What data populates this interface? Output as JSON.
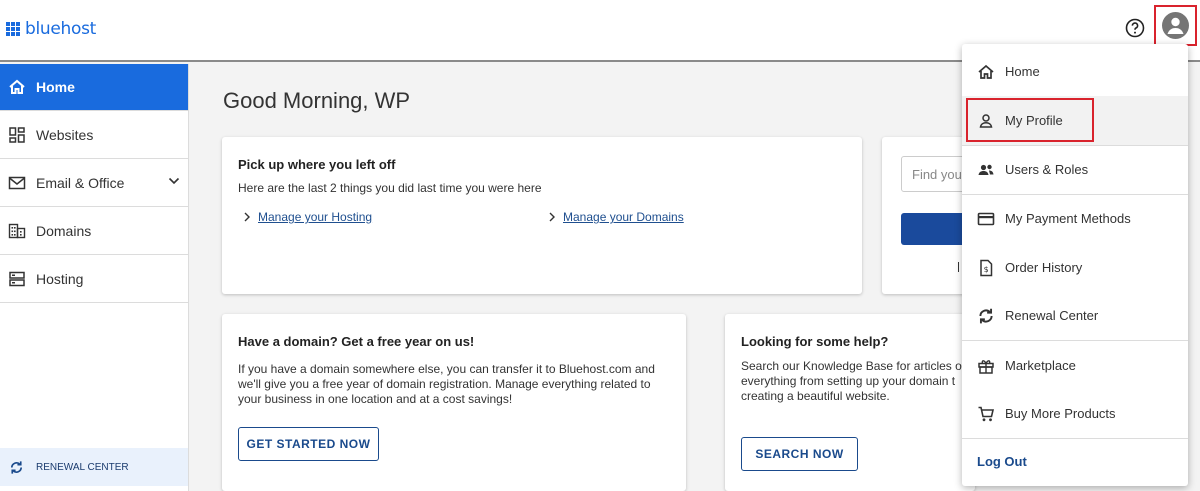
{
  "brand": {
    "name": "bluehost",
    "color": "#196bde"
  },
  "header": {
    "help_icon": "help-circle-icon",
    "avatar_icon": "account-circle-icon"
  },
  "sidebar": {
    "items": [
      {
        "label": "Home",
        "icon": "home-icon",
        "active": true
      },
      {
        "label": "Websites",
        "icon": "dashboard-icon"
      },
      {
        "label": "Email & Office",
        "icon": "mail-icon",
        "expandable": true
      },
      {
        "label": "Domains",
        "icon": "building-icon"
      },
      {
        "label": "Hosting",
        "icon": "server-icon"
      }
    ],
    "renewal_label": "RENEWAL CENTER"
  },
  "main": {
    "greeting": "Good Morning, WP",
    "pickup_card": {
      "title": "Pick up where you left off",
      "subtitle": "Here are the last 2 things you did last time you were here",
      "links": [
        "Manage your Hosting",
        "Manage your Domains"
      ]
    },
    "search_card": {
      "placeholder": "Find you"
    },
    "domain_card": {
      "title": "Have a domain? Get a free year on us!",
      "body": "If you have a domain somewhere else, you can transfer it to Bluehost.com and we'll give you a free year of domain registration. Manage everything related to your business in one location and at a cost savings!",
      "button": "GET STARTED NOW"
    },
    "help_card": {
      "title": "Looking for some help?",
      "body_lines": [
        "Search our Knowledge Base for articles o",
        "everything from setting up your domain t",
        "creating a beautiful website."
      ],
      "button": "SEARCH NOW"
    }
  },
  "menu": {
    "items": [
      {
        "label": "Home",
        "icon": "home-icon"
      },
      {
        "label": "My Profile",
        "icon": "person-icon"
      },
      {
        "label": "Users & Roles",
        "icon": "people-icon"
      },
      {
        "label": "My Payment Methods",
        "icon": "credit-card-icon"
      },
      {
        "label": "Order History",
        "icon": "receipt-icon"
      },
      {
        "label": "Renewal Center",
        "icon": "refresh-icon"
      },
      {
        "label": "Marketplace",
        "icon": "gift-icon"
      },
      {
        "label": "Buy More Products",
        "icon": "cart-icon"
      }
    ],
    "logout": "Log Out"
  },
  "colors": {
    "accent": "#196bde",
    "highlight_border": "#d9232d",
    "button_blue": "#1a4a8c"
  }
}
